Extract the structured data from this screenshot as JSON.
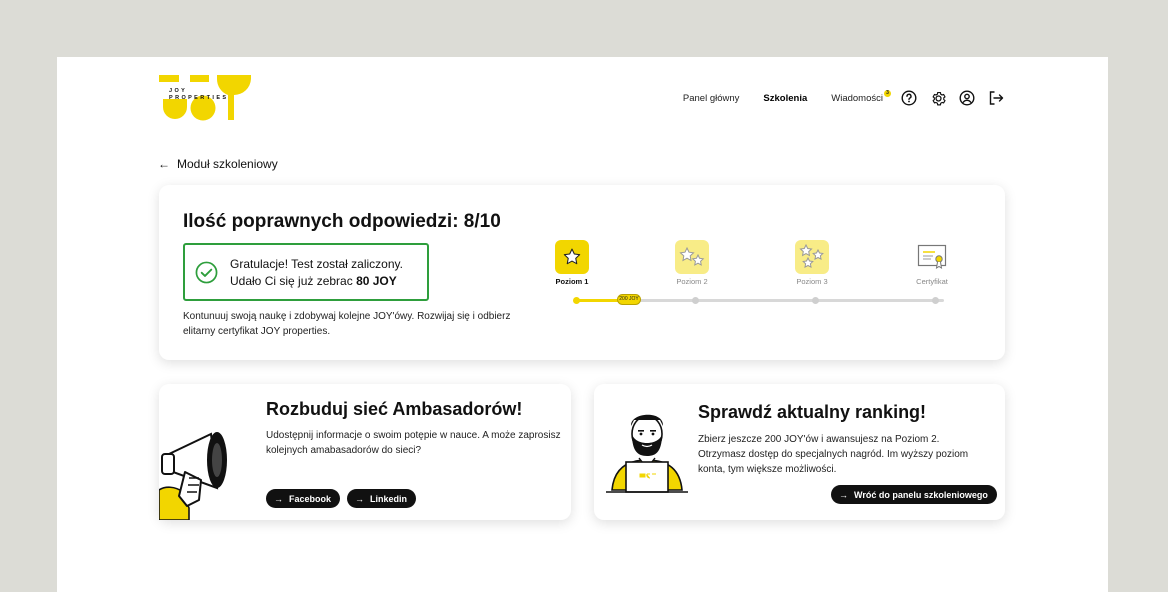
{
  "brand": {
    "logo_text_line1": "JOY",
    "logo_text_line2": "PROPERTIES",
    "accent": "#F2D600"
  },
  "nav": {
    "items": [
      "Panel główny",
      "Szkolenia",
      "Wiadomości"
    ],
    "active": "Szkolenia",
    "messages_badge": "3",
    "icons": [
      "help-icon",
      "settings-icon",
      "user-icon",
      "logout-icon"
    ]
  },
  "back_link": "Moduł szkoleniowy",
  "result": {
    "title": "Ilość poprawnych odpowiedzi: 8/10",
    "success_line1": "Gratulacje! Test został zaliczony.",
    "success_line2_prefix": "Udało Ci się już zebrac ",
    "success_points": "80 JOY",
    "description": "Kontunuuj swoją naukę i zdobywaj kolejne JOY'ówy. Rozwijaj się i odbierz elitarny certyfikat JOY properties."
  },
  "levels": {
    "items": [
      {
        "label": "Poziom 1",
        "icon": "one-star-icon",
        "active": true
      },
      {
        "label": "Poziom 2",
        "icon": "two-stars-icon",
        "active": false
      },
      {
        "label": "Poziom 3",
        "icon": "three-stars-icon",
        "active": false
      },
      {
        "label": "Certyfikat",
        "icon": "certificate-icon",
        "active": false
      }
    ],
    "current_points_tag": "200 JOY",
    "progress_fraction": 0.14
  },
  "ambassadors": {
    "title": "Rozbuduj sieć Ambasadorów!",
    "text": "Udostępnij informacje o swoim potępie w nauce. A może zaprosisz kolejnych amabasadorów do sieci?",
    "buttons": [
      "Facebook",
      "Linkedin"
    ]
  },
  "ranking": {
    "title": "Sprawdź aktualny ranking!",
    "text": "Zbierz jeszcze 200 JOY'ów i awansujesz na Poziom 2. Otrzymasz dostęp do specjalnych nagród. Im wyższy poziom konta, tym większe możliwości.",
    "button": "Wróć do panelu szkoleniowego"
  }
}
